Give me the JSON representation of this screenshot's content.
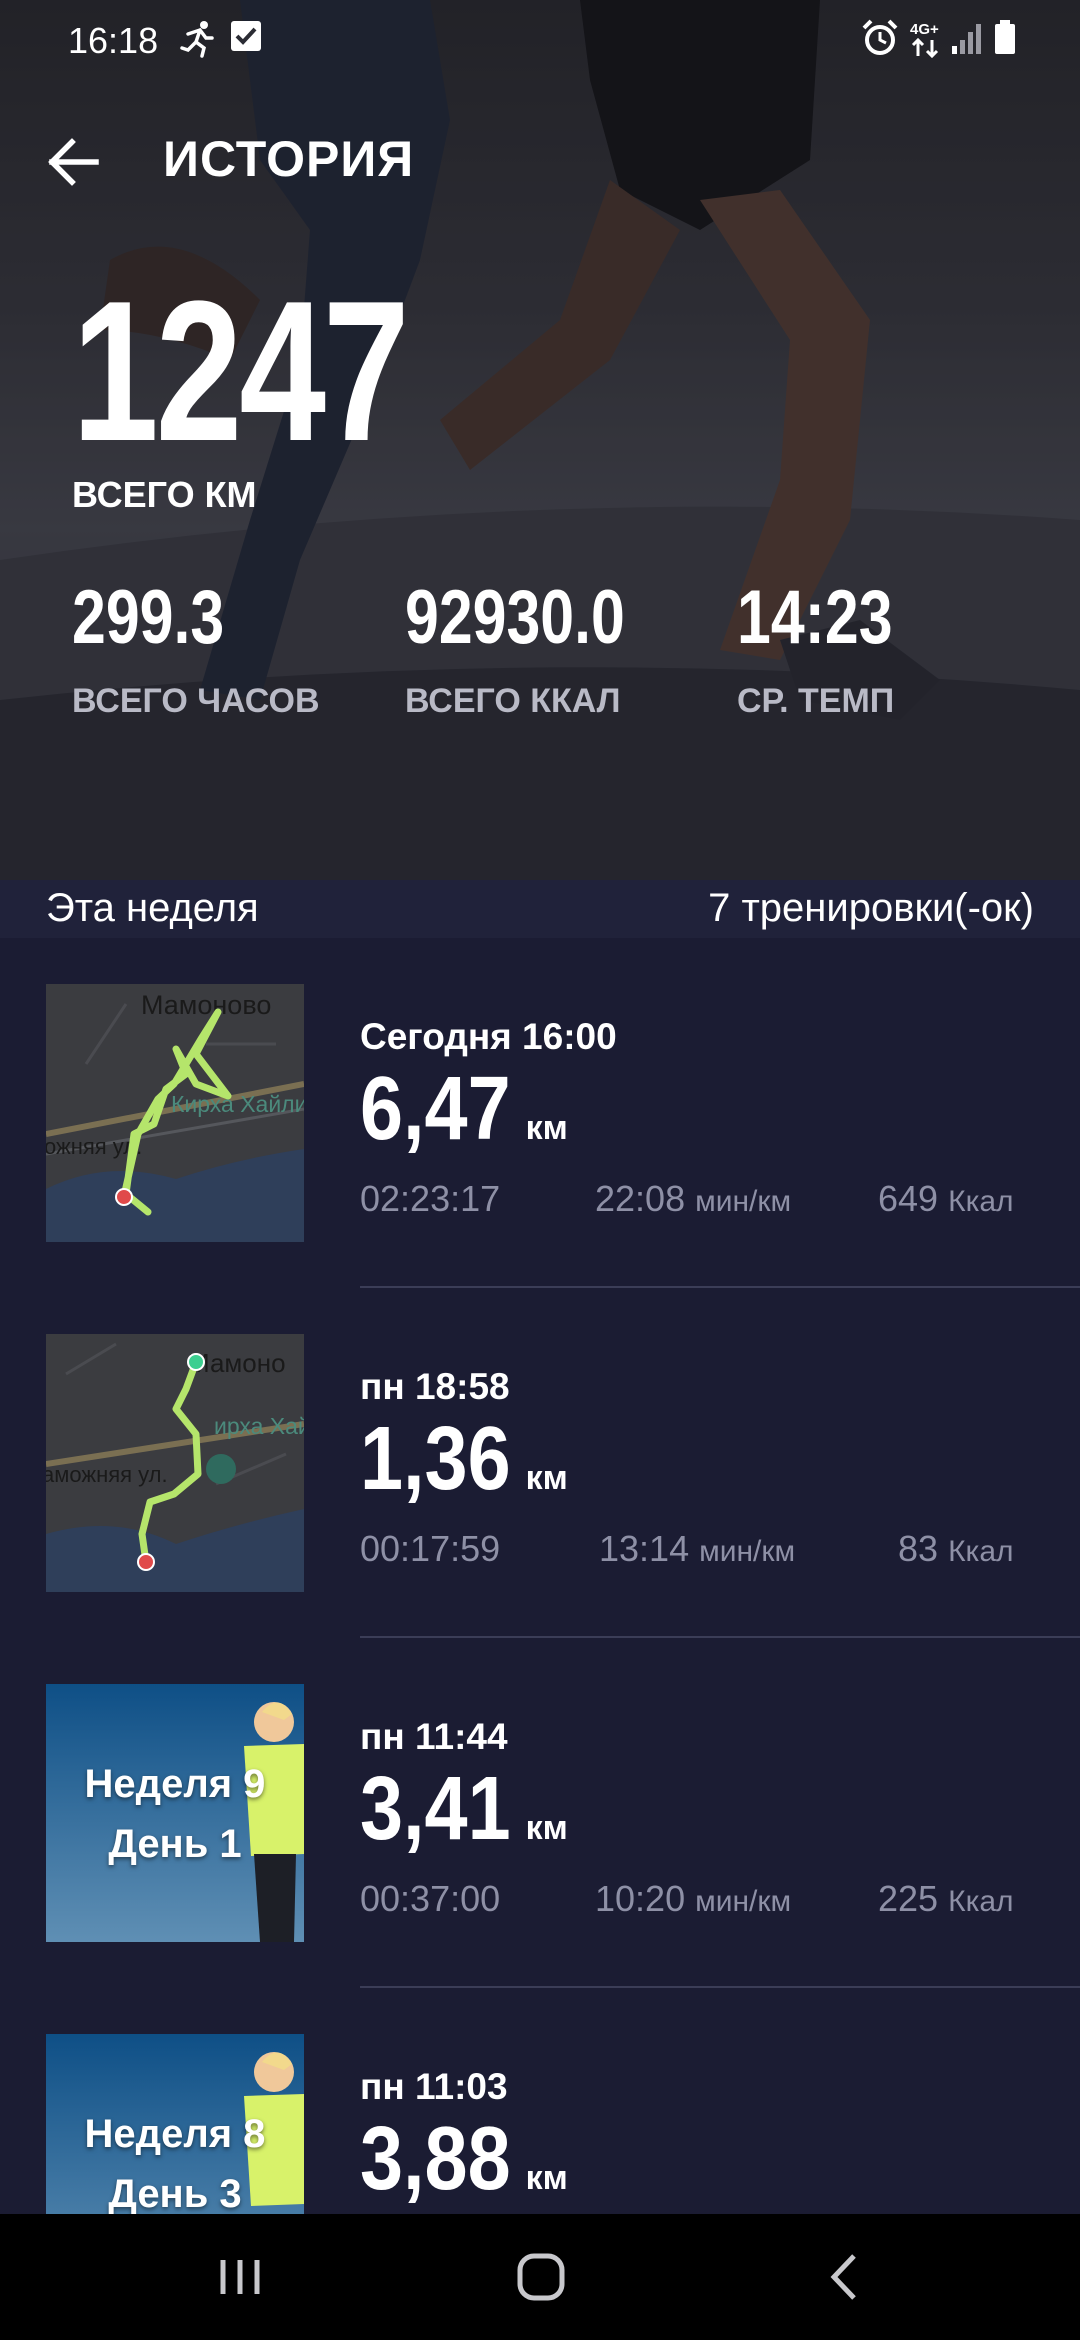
{
  "status_bar": {
    "time": "16:18",
    "icons": [
      "running-icon",
      "check-box-icon",
      "alarm-icon",
      "4g-icon",
      "signal-icon",
      "battery-icon"
    ],
    "network_label": "4G+"
  },
  "header": {
    "title": "ИСТОРИЯ"
  },
  "totals": {
    "distance_value": "1247",
    "distance_label": "ВСЕГО КМ",
    "stats": [
      {
        "value": "299.3",
        "label": "ВСЕГО ЧАСОВ"
      },
      {
        "value": "92930.0",
        "label": "ВСЕГО ККАЛ"
      },
      {
        "value": "14:23",
        "label": "СР. ТЕМП"
      }
    ]
  },
  "week": {
    "title": "Эта неделя",
    "count": "7 тренировки(-ок)"
  },
  "units": {
    "distance": "км",
    "pace": "мин/км",
    "calories": "Ккал"
  },
  "workouts": [
    {
      "when": "Сегодня 16:00",
      "distance": "6,47",
      "duration": "02:23:17",
      "pace": "22:08",
      "calories": "649",
      "map_labels": [
        "Мамоново",
        "Кирха Хайлиг",
        "ожняя ул."
      ]
    },
    {
      "when": "пн 18:58",
      "distance": "1,36",
      "duration": "00:17:59",
      "pace": "13:14",
      "calories": "83",
      "map_labels": [
        "Мамоно",
        "ирха Хай",
        "аможняя ул."
      ]
    },
    {
      "when": "пн 11:44",
      "distance": "3,41",
      "duration": "00:37:00",
      "pace": "10:20",
      "calories": "225",
      "promo_line1": "Неделя 9",
      "promo_line2": "День 1"
    },
    {
      "when": "пн 11:03",
      "distance": "3,88",
      "promo_line1": "Неделя 8",
      "promo_line2": "День 3"
    }
  ],
  "colors": {
    "background": "#1b1c33",
    "route": "#b5e56b",
    "meta_text": "#8e90a6"
  },
  "nav_bar": {
    "buttons": [
      "recent-apps-icon",
      "home-icon",
      "back-icon"
    ]
  }
}
